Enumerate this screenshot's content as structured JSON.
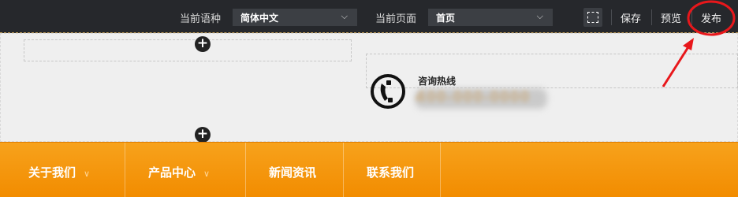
{
  "toolbar": {
    "language_label": "当前语种",
    "language_value": "简体中文",
    "page_label": "当前页面",
    "page_value": "首页",
    "save_label": "保存",
    "preview_label": "预览",
    "publish_label": "发布"
  },
  "header": {
    "hotline_title": "咨询热线",
    "hotline_number": "400-000-0000"
  },
  "nav": {
    "items": [
      {
        "label": "关于我们"
      },
      {
        "label": "产品中心"
      },
      {
        "label": "新闻资讯"
      },
      {
        "label": "联系我们"
      }
    ]
  },
  "colors": {
    "toolbar_bg": "#26282c",
    "nav_orange": "#f28c00",
    "annotation_red": "#e8171b"
  },
  "icons": [
    "chevron-down-icon",
    "frame-select-icon",
    "add-icon",
    "phone-icon"
  ]
}
